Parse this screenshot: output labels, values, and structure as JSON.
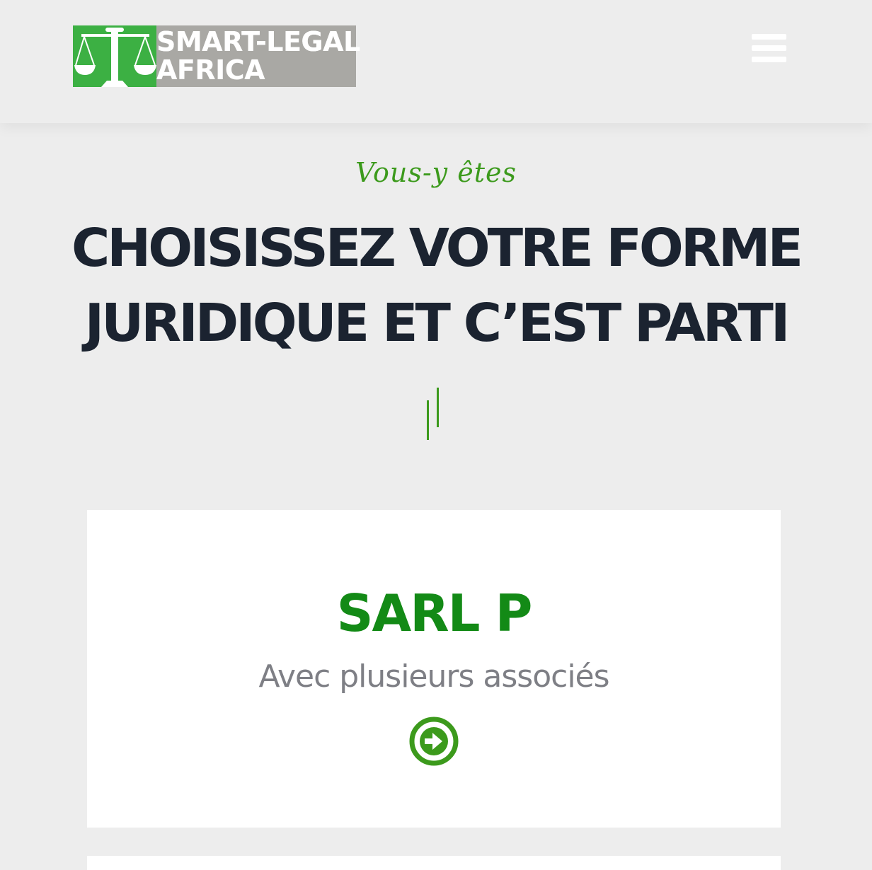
{
  "header": {
    "logo": {
      "line1": "SMART-LEGAL",
      "line2": "AFRICA"
    },
    "menu_icon": "hamburger-menu-icon"
  },
  "hero": {
    "eyebrow": "Vous-y êtes",
    "headline_line1": "CHOISISSEZ VOTRE FORME",
    "headline_line2": "JURIDIQUE ET C’EST PARTI"
  },
  "cards": [
    {
      "title": "SARL P",
      "subtitle": "Avec plusieurs associés",
      "icon": "arrow-circle-right-icon"
    }
  ],
  "colors": {
    "accent_green": "#3c9a1c",
    "title_green": "#138a16",
    "logo_green": "#3cb043",
    "logo_grey": "#a9a8a4",
    "headline": "#1b2330",
    "subtitle_grey": "#7e7f85",
    "background": "#ededed"
  }
}
